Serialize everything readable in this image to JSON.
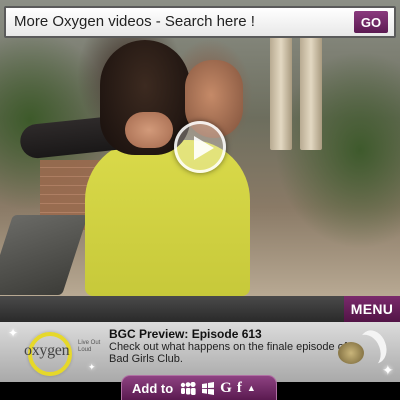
{
  "search": {
    "text": "More Oxygen videos - Search here !",
    "go_label": "GO"
  },
  "player": {
    "play_icon": "play-icon"
  },
  "menu": {
    "label": "MENU"
  },
  "info": {
    "logo_word": "oxygen",
    "logo_tag": "Live Out Loud",
    "title": "BGC Preview: Episode 613",
    "description": "Check out what happens on the finale episode of Bad Girls Club."
  },
  "addto": {
    "label": "Add to",
    "icons": [
      "myspace-icon",
      "windows-icon",
      "google-icon",
      "facebook-icon",
      "arrow-up-icon"
    ],
    "g_glyph": "G",
    "f_glyph": "f",
    "up_glyph": "▲"
  },
  "colors": {
    "accent": "#6e2462",
    "go": "#5c1a52",
    "logo_ring": "#e6d82a"
  }
}
